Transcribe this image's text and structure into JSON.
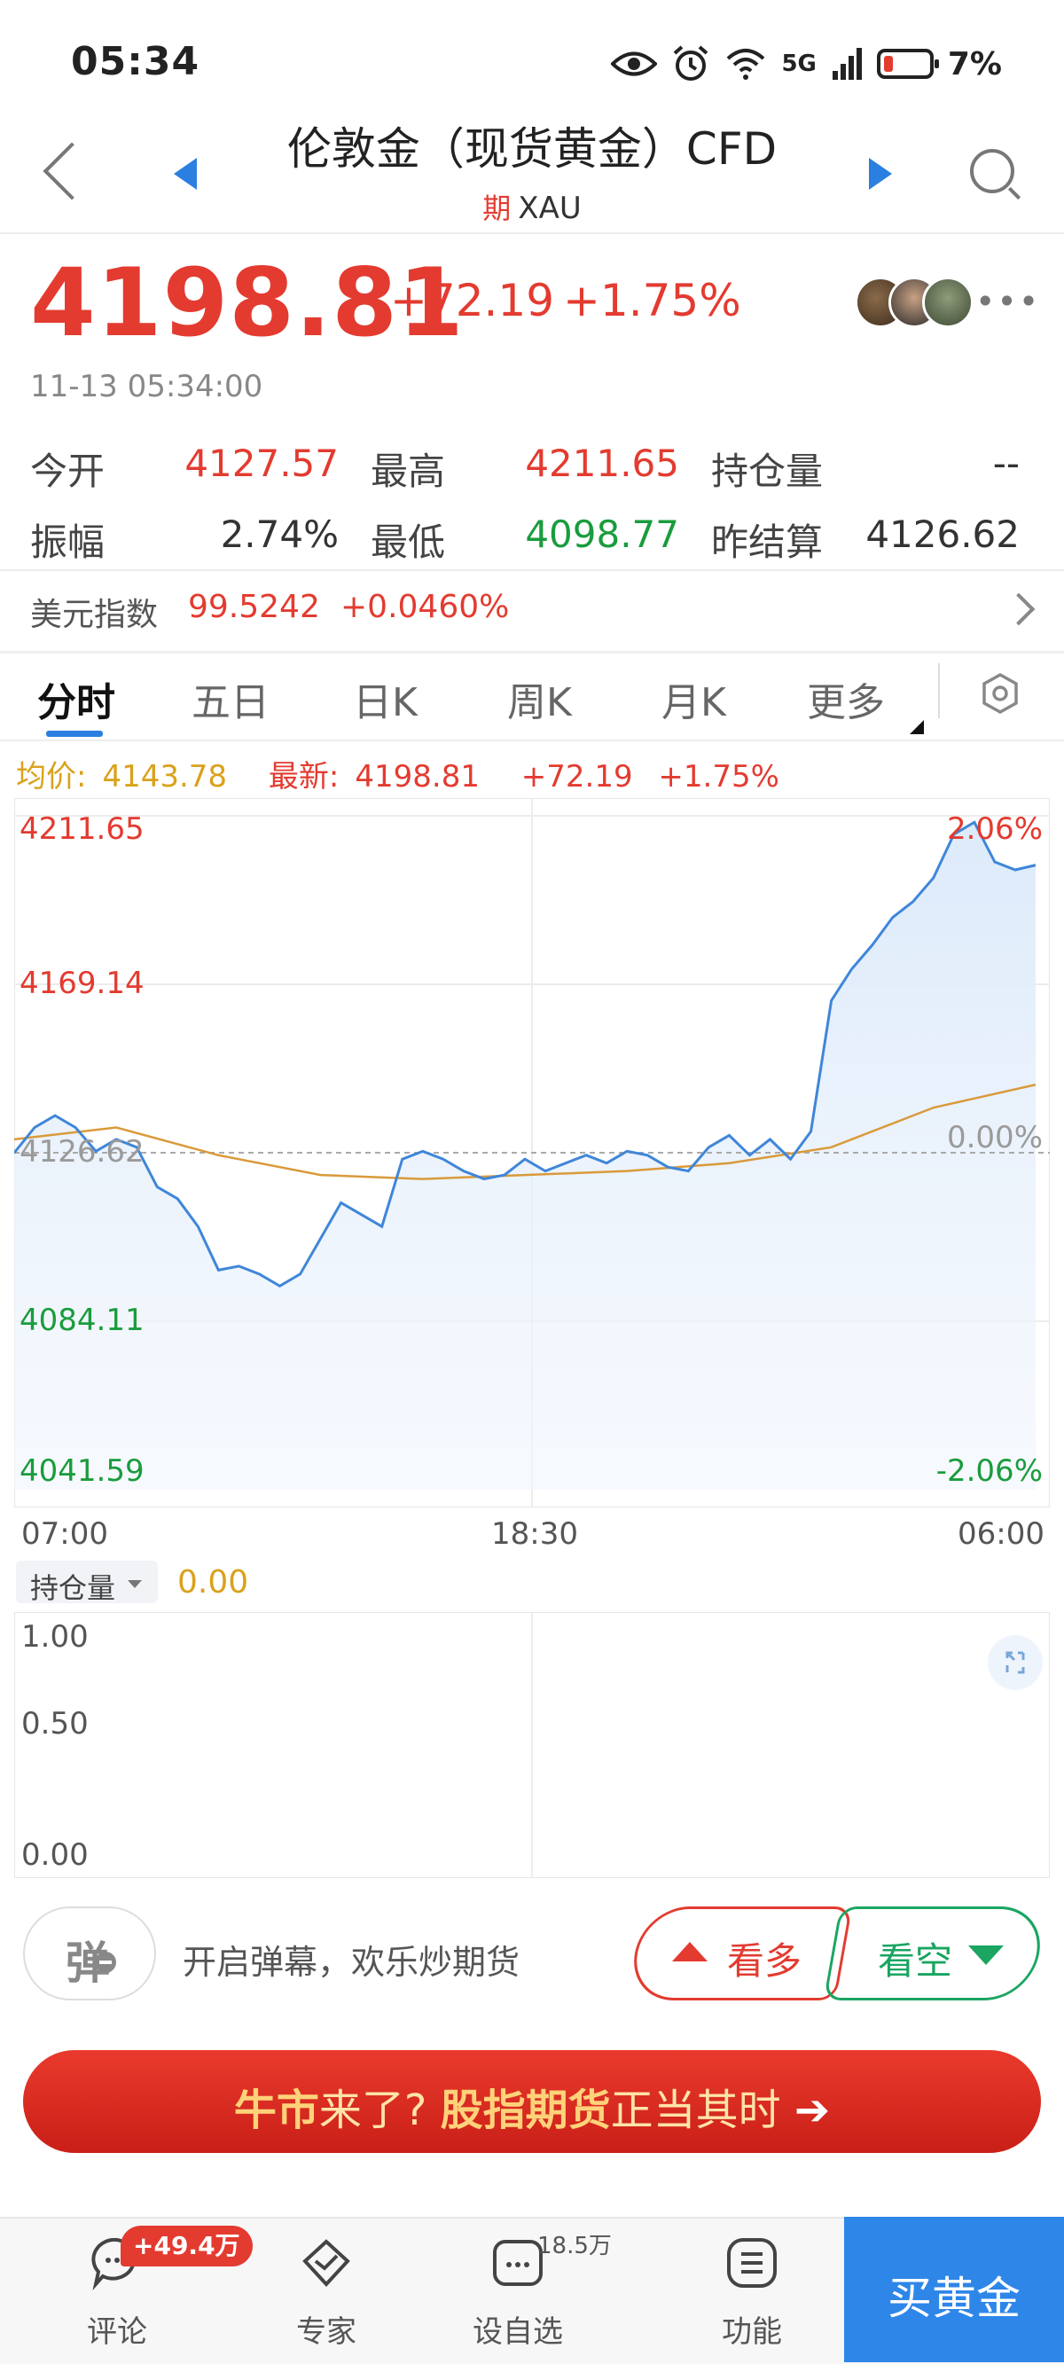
{
  "status_bar": {
    "time": "05:34",
    "battery": "7%",
    "network": "5G"
  },
  "header": {
    "title": "伦敦金（现货黄金）CFD",
    "tag": "期",
    "symbol": "XAU"
  },
  "quote": {
    "price": "4198.81",
    "change": "+72.19",
    "change_pct": "+1.75%",
    "timestamp": "11-13 05:34:00"
  },
  "stats": {
    "open_label": "今开",
    "open": "4127.57",
    "high_label": "最高",
    "high": "4211.65",
    "oi_label": "持仓量",
    "oi": "--",
    "amp_label": "振幅",
    "amp": "2.74%",
    "low_label": "最低",
    "low": "4098.77",
    "settle_label": "昨结算",
    "settle": "4126.62"
  },
  "dollar_index": {
    "label": "美元指数",
    "value": "99.5242",
    "change": "+0.0460%"
  },
  "tabs": [
    "分时",
    "五日",
    "日K",
    "周K",
    "月K",
    "更多"
  ],
  "info_line": {
    "avg_label": "均价:",
    "avg": "4143.78",
    "latest_label": "最新:",
    "latest": "4198.81",
    "change": "+72.19",
    "change_pct": "+1.75%"
  },
  "chart_data": {
    "type": "line",
    "title": "",
    "y_left_ticks": [
      "4211.65",
      "4169.14",
      "4126.62",
      "4084.11",
      "4041.59"
    ],
    "y_right_ticks": [
      "2.06%",
      "0.00%",
      "-2.06%"
    ],
    "x_ticks": [
      "07:00",
      "18:30",
      "06:00"
    ],
    "ylim": [
      4041.59,
      4211.65
    ],
    "reference_price": 4126.62,
    "series": [
      {
        "x": [
          0,
          2,
          4,
          6,
          8,
          10,
          12,
          14,
          16,
          18,
          20,
          22,
          24,
          26,
          28,
          30,
          32,
          34,
          36,
          38,
          40,
          42,
          44,
          46,
          48,
          50,
          52,
          54,
          56,
          58,
          60,
          62,
          64,
          66,
          68,
          70,
          72,
          74,
          76,
          78,
          80,
          82,
          84,
          86,
          88,
          90,
          92,
          94,
          96,
          98,
          100
        ],
        "values": [
          4126.6,
          4133,
          4136,
          4133,
          4127,
          4130,
          4128,
          4118,
          4115,
          4108,
          4097,
          4098,
          4096,
          4093,
          4096,
          4105,
          4114,
          4111,
          4108,
          4125,
          4127,
          4125,
          4122,
          4120,
          4121,
          4125,
          4122,
          4124,
          4126,
          4124,
          4127,
          4126,
          4123,
          4122,
          4128,
          4131,
          4126,
          4130,
          4125,
          4132,
          4165,
          4173,
          4179,
          4186,
          4190,
          4196,
          4207,
          4210,
          4200,
          4198,
          4199.2
        ]
      },
      {
        "x": [
          0,
          10,
          20,
          30,
          40,
          50,
          60,
          70,
          80,
          90,
          100
        ],
        "values": [
          4130,
          4133,
          4126,
          4121,
          4120,
          4121,
          4122,
          4124,
          4128,
          4138,
          4143.8
        ]
      }
    ]
  },
  "volume_panel": {
    "label": "持仓量",
    "value": "0.00",
    "y_ticks": [
      "1.00",
      "0.50",
      "0.00"
    ]
  },
  "danmu": {
    "icon_char": "弹",
    "text": "开启弹幕，欢乐炒期货"
  },
  "bull_label": "看多",
  "bear_label": "看空",
  "banner": {
    "part1": "牛市",
    "part2": "来了?",
    "part3": "股指期货",
    "part4": "正当其时",
    "arrow": "➔"
  },
  "bottom_nav": {
    "comments": "评论",
    "comments_badge": "+49.4万",
    "experts": "专家",
    "watchlist": "设自选",
    "watchlist_count": "18.5万",
    "functions": "功能",
    "buy": "买黄金"
  },
  "colors": {
    "up": "#e33b30",
    "down": "#1a9c3c",
    "accent": "#2b7fe0",
    "avg_line": "#d99a3a",
    "price_line": "#3f86d9"
  }
}
